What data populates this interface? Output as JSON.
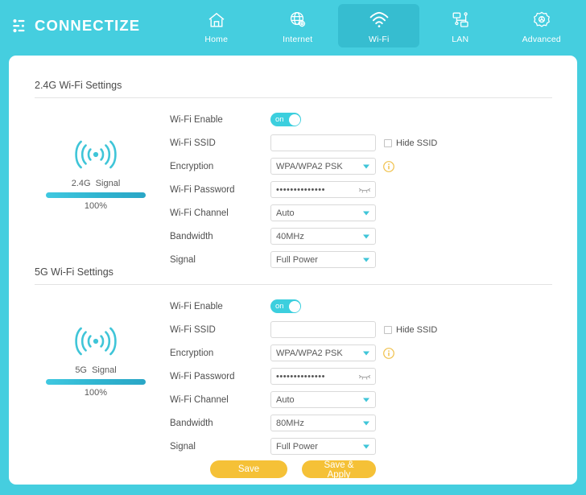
{
  "brand": {
    "name": "CONNECTIZE",
    "logo_icon": "connectize-dots-logo"
  },
  "nav": {
    "items": [
      {
        "label": "Home",
        "icon": "home-icon",
        "active": false
      },
      {
        "label": "Internet",
        "icon": "globe-gear-icon",
        "active": false
      },
      {
        "label": "Wi-Fi",
        "icon": "wifi-icon",
        "active": true
      },
      {
        "label": "LAN",
        "icon": "lan-icon",
        "active": false
      },
      {
        "label": "Advanced",
        "icon": "gear-badge-icon",
        "active": false
      }
    ]
  },
  "colors": {
    "page_bg": "#45CEDF",
    "nav_active": "#36BDD0",
    "accent_teal": "#3FC5D8",
    "button_yellow": "#F5C137",
    "info_yellow": "#F0C14B"
  },
  "labels": {
    "wifi_enable": "Wi-Fi Enable",
    "wifi_ssid": "Wi-Fi SSID",
    "encryption": "Encryption",
    "wifi_password": "Wi-Fi Password",
    "wifi_channel": "Wi-Fi Channel",
    "bandwidth": "Bandwidth",
    "signal": "Signal",
    "hide_ssid": "Hide SSID"
  },
  "sections": [
    {
      "title": "2.4G Wi-Fi Settings",
      "signal": {
        "icon": "wifi-signal-icon",
        "label": "2.4G  Signal",
        "percent_text": "100%",
        "percent": 100
      },
      "fields": {
        "wifi_enable": {
          "state": "on",
          "toggle_text": "on"
        },
        "wifi_ssid": {
          "value": "",
          "placeholder": ""
        },
        "hide_ssid": {
          "checked": false
        },
        "encryption": {
          "value": "WPA/WPA2 PSK"
        },
        "wifi_password": {
          "value": "••••••••••••••",
          "masked": true,
          "reveal_icon": "eye-closed-icon"
        },
        "wifi_channel": {
          "value": "Auto"
        },
        "bandwidth": {
          "value": "40MHz"
        },
        "signal_power": {
          "value": "Full Power"
        }
      }
    },
    {
      "title": "5G Wi-Fi Settings",
      "signal": {
        "icon": "wifi-signal-icon",
        "label": "5G  Signal",
        "percent_text": "100%",
        "percent": 100
      },
      "fields": {
        "wifi_enable": {
          "state": "on",
          "toggle_text": "on"
        },
        "wifi_ssid": {
          "value": "",
          "placeholder": ""
        },
        "hide_ssid": {
          "checked": false
        },
        "encryption": {
          "value": "WPA/WPA2 PSK"
        },
        "wifi_password": {
          "value": "••••••••••••••",
          "masked": true,
          "reveal_icon": "eye-closed-icon"
        },
        "wifi_channel": {
          "value": "Auto"
        },
        "bandwidth": {
          "value": "80MHz"
        },
        "signal_power": {
          "value": "Full Power"
        }
      }
    }
  ],
  "buttons": {
    "save": "Save",
    "save_apply": "Save & Apply"
  }
}
